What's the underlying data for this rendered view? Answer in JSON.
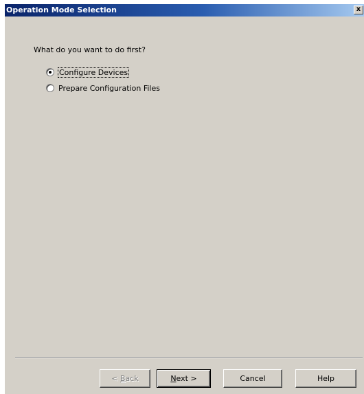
{
  "window": {
    "title": "Operation Mode Selection",
    "close_glyph": "x"
  },
  "main": {
    "question": "What do you want to do first?",
    "options": [
      {
        "label": "Configure Devices",
        "selected": true,
        "focused": true
      },
      {
        "label": "Prepare Configuration Files",
        "selected": false,
        "focused": false
      }
    ]
  },
  "buttons": {
    "back": {
      "mnemonic": "B",
      "rest": "ack",
      "prefix": "< ",
      "enabled": false
    },
    "next": {
      "prefix": "",
      "mnemonic": "N",
      "rest": "ext >",
      "enabled": true,
      "default": true
    },
    "cancel": {
      "label": "Cancel"
    },
    "help": {
      "label": "Help"
    }
  },
  "colors": {
    "titlebar_start": "#0a246a",
    "titlebar_end": "#a6caf0",
    "dialog_bg": "#d4d0c8"
  }
}
